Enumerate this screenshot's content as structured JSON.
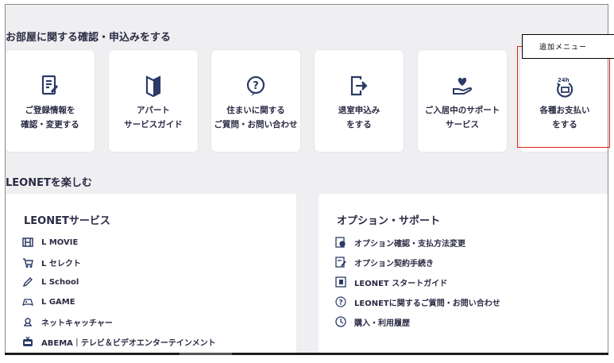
{
  "section1": {
    "title": "お部屋に関する確認・申込みをする",
    "cards": [
      {
        "label": "ご登録情報を\n確認・変更する",
        "icon": "document-edit-icon"
      },
      {
        "label": "アパート\nサービスガイド",
        "icon": "bookmark-icon"
      },
      {
        "label": "住まいに関する\nご質問・お問い合わせ",
        "icon": "question-icon"
      },
      {
        "label": "退室申込み\nをする",
        "icon": "exit-door-icon"
      },
      {
        "label": "ご入居中のサポート\nサービス",
        "icon": "heart-hand-icon"
      },
      {
        "label": "各種お支払い\nをする",
        "icon": "24h-payment-icon"
      }
    ]
  },
  "annotation": {
    "label": "追加メニュー",
    "color": "#e2231a"
  },
  "section2": {
    "title": "LEONETを楽しむ",
    "services": {
      "title": "LEONETサービス",
      "items": [
        {
          "label": "L MOVIE",
          "icon": "film-icon"
        },
        {
          "label": "L セレクト",
          "icon": "cart-icon"
        },
        {
          "label": "L School",
          "icon": "pencil-icon"
        },
        {
          "label": "L GAME",
          "icon": "gamepad-icon"
        },
        {
          "label": "ネットキャッチャー",
          "icon": "claw-icon"
        },
        {
          "label": "ABEMA｜テレビ＆ビデオエンターテインメント",
          "icon": "tv-icon"
        }
      ]
    },
    "options": {
      "title": "オプション・サポート",
      "items": [
        {
          "label": "オプション確認・支払方法変更",
          "icon": "option-card-icon"
        },
        {
          "label": "オプション契約手続き",
          "icon": "contract-edit-icon"
        },
        {
          "label": "LEONET スタートガイド",
          "icon": "guide-book-icon"
        },
        {
          "label": "LEONETに関するご質問・お問い合わせ",
          "icon": "question-circle-icon"
        },
        {
          "label": "購入・利用履歴",
          "icon": "clock-icon"
        }
      ]
    }
  },
  "colors": {
    "accent": "#2b3a67",
    "background": "#efeff1",
    "card": "#ffffff",
    "text": "#2a2a44"
  }
}
